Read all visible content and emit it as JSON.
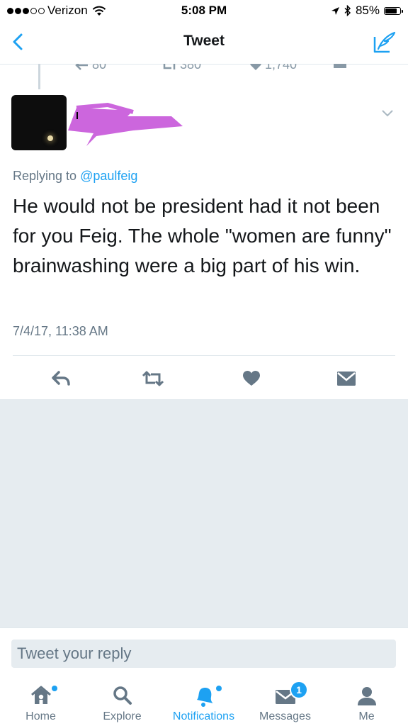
{
  "status_bar": {
    "carrier": "Verizon",
    "time": "5:08 PM",
    "battery": "85%",
    "battery_level": 0.85
  },
  "nav": {
    "title": "Tweet"
  },
  "previous_tweet": {
    "replies": "80",
    "retweets": "380",
    "likes": "1,740"
  },
  "tweet": {
    "replying_label": "Replying to",
    "replying_handle": "@paulfeig",
    "text": "He would not be president had it not been for you Feig. The whole \"women are funny\" brainwashing were a big part of his win.",
    "timestamp": "7/4/17, 11:38 AM"
  },
  "reply_box": {
    "placeholder": "Tweet your reply"
  },
  "tabs": [
    {
      "label": "Home",
      "icon": "home-icon",
      "has_dot": true
    },
    {
      "label": "Explore",
      "icon": "search-icon"
    },
    {
      "label": "Notifications",
      "icon": "bell-icon",
      "active": true,
      "has_dot": true
    },
    {
      "label": "Messages",
      "icon": "envelope-icon",
      "badge": "1"
    },
    {
      "label": "Me",
      "icon": "person-icon"
    }
  ],
  "colors": {
    "accent": "#1da1f2",
    "secondary_text": "#657786",
    "icon_gray": "#657786",
    "empty_background": "#e6ecf0",
    "redaction": "#cc66dd"
  }
}
